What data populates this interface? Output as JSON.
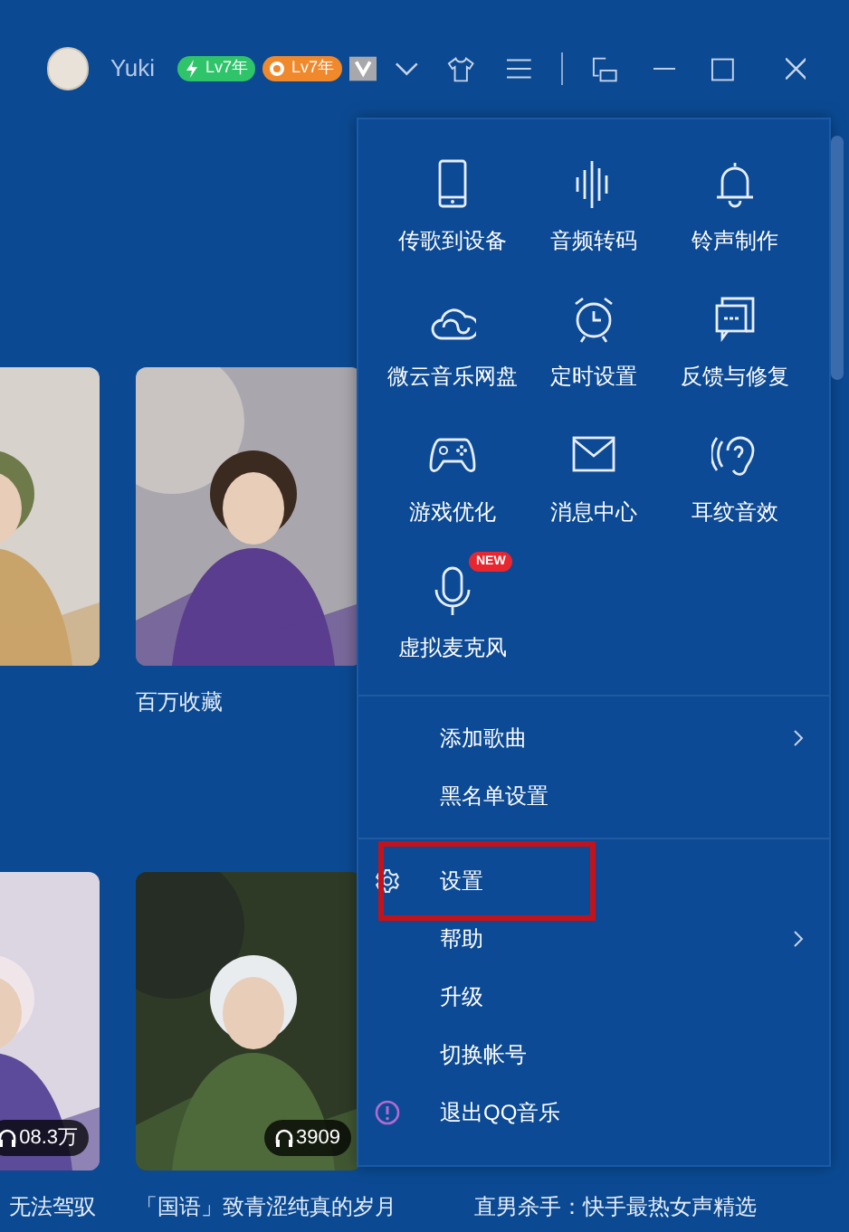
{
  "header": {
    "username": "Yuki",
    "badges": [
      {
        "text": "Lv7年",
        "color": "#2fc46a",
        "kind": "bolt"
      },
      {
        "text": "Lv7年",
        "color": "#f0882c",
        "kind": "ring"
      }
    ]
  },
  "rows": [
    {
      "cards": [
        {
          "kind": "picture"
        },
        {
          "kind": "picture",
          "caption": "百万收藏"
        }
      ]
    },
    {
      "cards": [
        {
          "kind": "picture",
          "play_count": "08.3万",
          "caption": "无法驾驭"
        },
        {
          "kind": "picture",
          "play_count": "3909",
          "caption": "「国语」致青涩纯真的岁月"
        },
        {
          "kind": "hidden",
          "caption": "直男杀手：快手最热女声精选"
        }
      ]
    }
  ],
  "menu": {
    "tools": [
      {
        "label": "传歌到设备",
        "kind": "phone"
      },
      {
        "label": "音频转码",
        "kind": "wave"
      },
      {
        "label": "铃声制作",
        "kind": "bell"
      },
      {
        "label": "微云音乐网盘",
        "kind": "cloud"
      },
      {
        "label": "定时设置",
        "kind": "clock"
      },
      {
        "label": "反馈与修复",
        "kind": "feedback"
      },
      {
        "label": "游戏优化",
        "kind": "gamepad"
      },
      {
        "label": "消息中心",
        "kind": "mail"
      },
      {
        "label": "耳纹音效",
        "kind": "ear"
      },
      {
        "label": "虚拟麦克风",
        "kind": "mic",
        "badge": "NEW"
      }
    ],
    "groups": [
      [
        {
          "label": "添加歌曲",
          "kind": "plain",
          "submenu": true,
          "highlighted": false
        },
        {
          "label": "黑名单设置",
          "kind": "plain",
          "submenu": false,
          "highlighted": false
        }
      ],
      [
        {
          "label": "设置",
          "kind": "gear",
          "submenu": false,
          "highlighted": true
        },
        {
          "label": "帮助",
          "kind": "plain",
          "submenu": true,
          "highlighted": false
        },
        {
          "label": "升级",
          "kind": "plain",
          "submenu": false,
          "highlighted": false
        },
        {
          "label": "切换帐号",
          "kind": "plain",
          "submenu": false,
          "highlighted": false
        },
        {
          "label": "退出QQ音乐",
          "kind": "exit",
          "submenu": false,
          "highlighted": false
        }
      ]
    ]
  }
}
